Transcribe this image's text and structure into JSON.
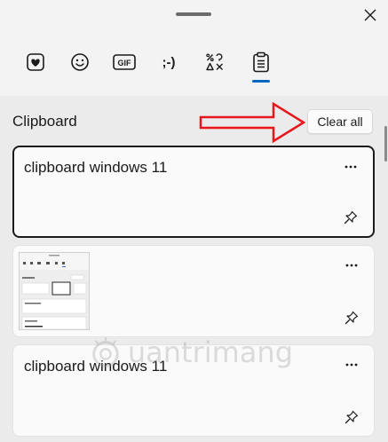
{
  "tabs": [
    {
      "name": "heart-emoji-icon",
      "label": ""
    },
    {
      "name": "smiley-icon",
      "label": ""
    },
    {
      "name": "gif-icon",
      "label": "GIF"
    },
    {
      "name": "kaomoji-icon",
      "label": ";-)"
    },
    {
      "name": "symbols-icon",
      "label": ""
    },
    {
      "name": "clipboard-icon",
      "label": ""
    }
  ],
  "active_tab": "clipboard",
  "clipboard": {
    "title": "Clipboard",
    "clear_label": "Clear all",
    "items": [
      {
        "type": "text",
        "text": "clipboard windows 11",
        "selected": true
      },
      {
        "type": "image",
        "text": "",
        "selected": false
      },
      {
        "type": "text",
        "text": "clipboard windows 11",
        "selected": false
      }
    ]
  },
  "watermark": "uantrimang",
  "colors": {
    "accent": "#0067c0",
    "annotation_arrow": "#e8151b",
    "panel_bg": "#ebebeb",
    "header_bg": "#f3f3f3"
  }
}
